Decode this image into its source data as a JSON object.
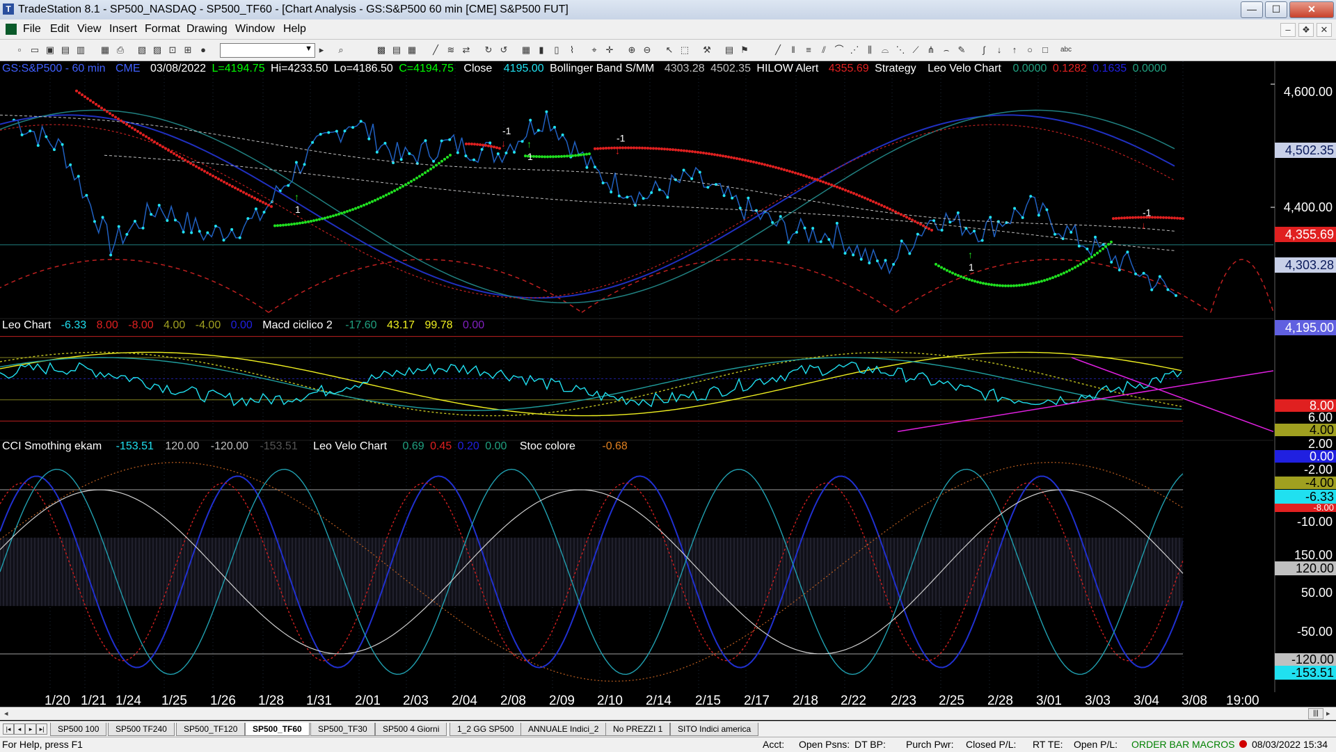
{
  "window": {
    "title": "TradeStation 8.1 - SP500_NASDAQ - SP500_TF60 - [Chart Analysis - GS:S&P500  60 min  [CME] S&P500 FUT]",
    "minimize": "—",
    "maximize": "☐",
    "close": "✕"
  },
  "menu": {
    "items": [
      "File",
      "Edit",
      "View",
      "Insert",
      "Format",
      "Drawing",
      "Window",
      "Help"
    ],
    "mdi": [
      "–",
      "❖",
      "✕"
    ]
  },
  "price_header": {
    "symbol": "GS:S&P500 - 60 min",
    "exchange": "CME",
    "date": "03/08/2022",
    "last": "L=4194.75",
    "high": "Hi=4233.50",
    "low": "Lo=4186.50",
    "close": "C=4194.75",
    "close_label": "Close",
    "close_value": "4195.00",
    "bb_label": "Bollinger Band S/MM",
    "bb_upper": "4303.28",
    "bb_lower": "4502.35",
    "hilow_label": "HILOW Alert",
    "hilow_value": "4355.69",
    "strategy_label": "Strategy",
    "velo_label": "Leo Velo Chart",
    "velo_values": [
      "0.0000",
      "0.1282",
      "0.1635",
      "0.0000"
    ]
  },
  "leo_header": {
    "label": "Leo Chart",
    "values": [
      "-6.33",
      "8.00",
      "-8.00",
      "4.00",
      "-4.00",
      "0.00"
    ],
    "macd_label": "Macd ciclico 2",
    "macd_values": [
      "-17.60",
      "43.17",
      "99.78",
      "0.00"
    ]
  },
  "cci_header": {
    "label": "CCI Smothing ekam",
    "values": [
      "-153.51",
      "120.00",
      "-120.00",
      "-153.51"
    ],
    "velo_label": "Leo Velo Chart",
    "velo_values": [
      "0.69",
      "0.45",
      "0.20",
      "0.00"
    ],
    "stoc_label": "Stoc colore",
    "stoc_value": "-0.68"
  },
  "price_axis": {
    "ticks": [
      "4,600.00",
      "4,400.00"
    ],
    "labels": [
      {
        "text": "4,502.35",
        "color": "#0a1a5a",
        "bg": "#c8d0e8"
      },
      {
        "text": "4,355.69",
        "color": "#ffffff",
        "bg": "#e02020"
      },
      {
        "text": "4,303.28",
        "color": "#0a1a5a",
        "bg": "#c8d0e8"
      },
      {
        "text": "4,195.00",
        "color": "#ffffff",
        "bg": "#6060e0"
      }
    ]
  },
  "leo_axis": {
    "ticks": [
      "6.00",
      "2.00",
      "-2.00",
      "-10.00"
    ],
    "labels": [
      {
        "text": "8.00",
        "color": "#ffffff",
        "bg": "#e02020"
      },
      {
        "text": "4.00",
        "color": "#000000",
        "bg": "#a0a020"
      },
      {
        "text": "0.00",
        "color": "#ffffff",
        "bg": "#2020e0"
      },
      {
        "text": "-4.00",
        "color": "#000000",
        "bg": "#a0a020"
      },
      {
        "text": "-6.33",
        "color": "#000000",
        "bg": "#20e0f0"
      },
      {
        "text": "-8.00",
        "color": "#ffffff",
        "bg": "#e02020"
      }
    ]
  },
  "cci_axis": {
    "ticks": [
      "150.00",
      "50.00",
      "-50.00"
    ],
    "labels": [
      {
        "text": "120.00",
        "color": "#000000",
        "bg": "#c0c0c0"
      },
      {
        "text": "-120.00",
        "color": "#000000",
        "bg": "#c0c0c0"
      },
      {
        "text": "-153.51",
        "color": "#000000",
        "bg": "#20e0f0"
      }
    ]
  },
  "markers": {
    "buy": "1",
    "sell": "-1"
  },
  "dates": [
    "1/20",
    "1/21",
    "1/24",
    "1/25",
    "1/26",
    "1/28",
    "1/31",
    "2/01",
    "2/03",
    "2/04",
    "2/08",
    "2/09",
    "2/10",
    "2/14",
    "2/15",
    "2/17",
    "2/18",
    "2/22",
    "2/23",
    "2/25",
    "2/28",
    "3/01",
    "3/03",
    "3/04",
    "3/08",
    "19:00"
  ],
  "tabs": [
    "SP500 100",
    "SP500 TF240",
    "SP500_TF120",
    "SP500_TF60",
    "SP500_TF30",
    "SP500 4 Giorni",
    "1_2 GG SP500",
    "ANNUALE Indici_2",
    "No PREZZI 1",
    "SITO Indici america"
  ],
  "active_tab": "SP500_TF60",
  "status": {
    "help": "For Help, press F1",
    "acct": "Acct:",
    "open_psns": "Open Psns:",
    "dt_bp": "DT BP:",
    "purch_pwr": "Purch Pwr:",
    "closed_pl": "Closed P/L:",
    "rt_te": "RT TE:",
    "open_pl": "Open P/L:",
    "order_bar": "ORDER BAR",
    "macros": "MACROS",
    "datetime": "08/03/2022 15:34"
  },
  "chart_data": {
    "type": "line",
    "symbol": "GS:S&P500",
    "interval": "60 min",
    "sessions": [
      "1/20",
      "1/21",
      "1/24",
      "1/25",
      "1/26",
      "1/28",
      "1/31",
      "2/01",
      "2/03",
      "2/04",
      "2/08",
      "2/09",
      "2/10",
      "2/14",
      "2/15",
      "2/17",
      "2/18",
      "2/22",
      "2/23",
      "2/25",
      "2/28",
      "3/01",
      "3/03",
      "3/04",
      "3/08"
    ],
    "ylim": [
      4150,
      4650
    ],
    "series": [
      {
        "name": "Close",
        "values": [
          4560,
          4500,
          4300,
          4380,
          4320,
          4350,
          4480,
          4560,
          4480,
          4510,
          4490,
          4570,
          4450,
          4400,
          4440,
          4380,
          4330,
          4320,
          4250,
          4360,
          4330,
          4380,
          4310,
          4260,
          4195
        ]
      }
    ],
    "bollinger": {
      "upper": 4502.35,
      "lower": 4303.28
    },
    "hilow_alert": 4355.69,
    "last": 4194.75,
    "high": 4233.5,
    "low": 4186.5,
    "leo_chart": {
      "value": -6.33,
      "levels": [
        8,
        -8,
        4,
        -4,
        0
      ],
      "ylim": [
        -11,
        9
      ]
    },
    "macd_ciclico_2": [
      -17.6,
      43.17,
      99.78,
      0.0
    ],
    "cci_smoothing": {
      "value": -153.51,
      "levels": [
        120,
        -120
      ],
      "ylim": [
        -175,
        175
      ]
    },
    "stoc_colore": -0.68
  }
}
